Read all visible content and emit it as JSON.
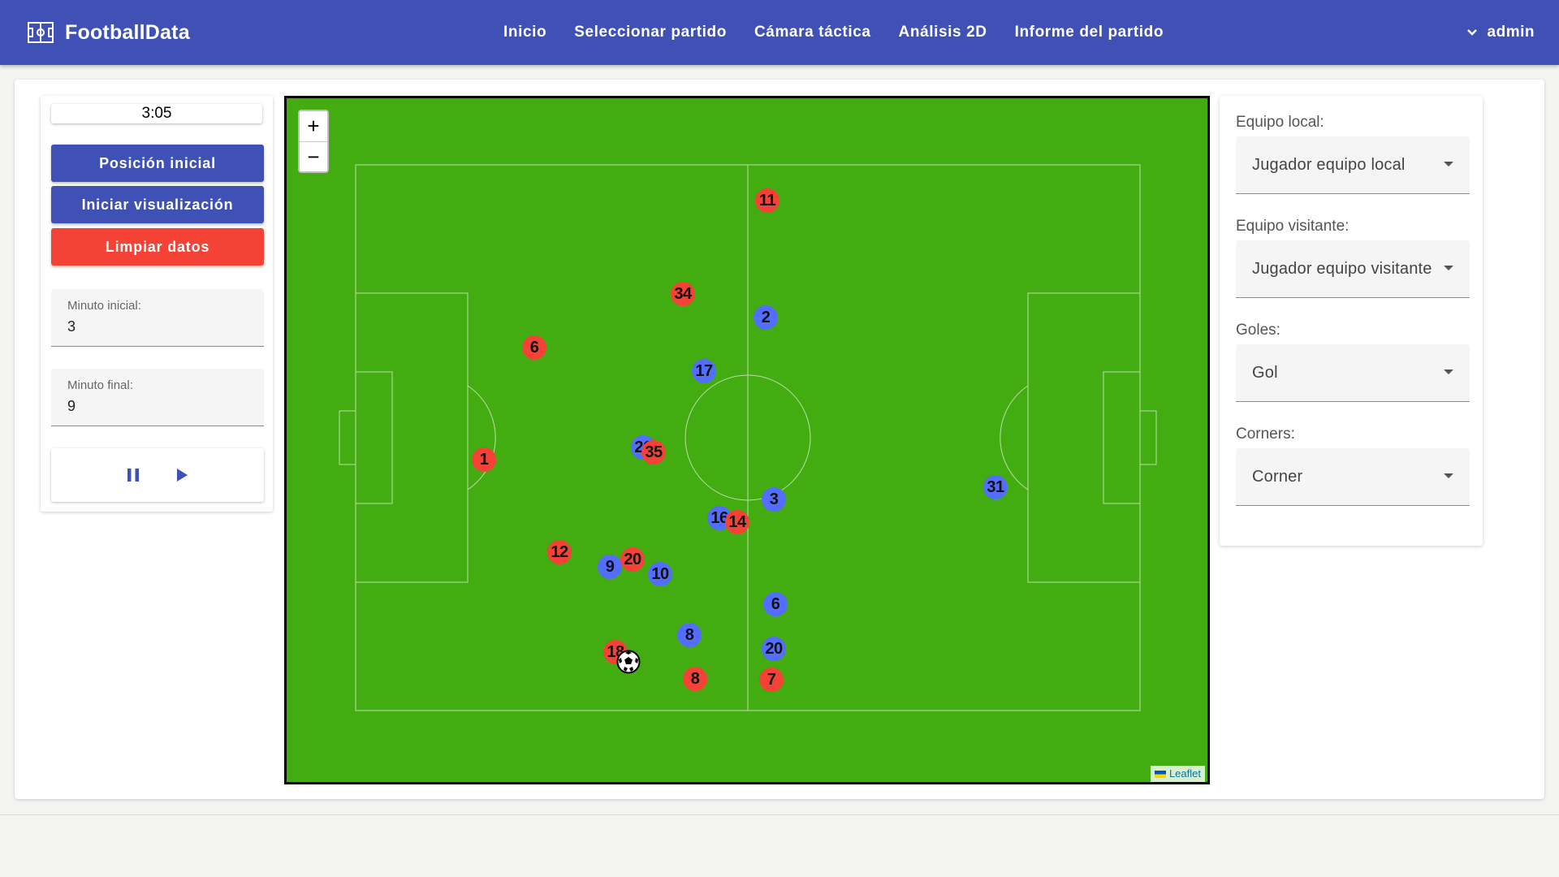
{
  "app": {
    "brand": "FootballData",
    "brand_icon": "pitch-icon"
  },
  "nav": {
    "items": [
      "Inicio",
      "Seleccionar partido",
      "Cámara táctica",
      "Análisis 2D",
      "Informe del partido"
    ],
    "user": "admin"
  },
  "left_panel": {
    "time": "3:05",
    "buttons": {
      "initial_position": "Posición inicial",
      "start_view": "Iniciar visualización",
      "clear_data": "Limpiar datos"
    },
    "start_minute": {
      "label": "Minuto inicial:",
      "value": "3"
    },
    "end_minute": {
      "label": "Minuto final:",
      "value": "9"
    },
    "playback": {
      "pause_icon": "pause-icon",
      "play_icon": "play-icon"
    }
  },
  "map": {
    "zoom_in": "+",
    "zoom_out": "−",
    "attribution": "Leaflet",
    "colors": {
      "pitch": "#43ac10",
      "home": "#f44336",
      "away": "#536dfe"
    },
    "home_players": [
      "11",
      "34",
      "6",
      "1",
      "35",
      "14",
      "12",
      "20",
      "18",
      "8",
      "7"
    ],
    "away_players": [
      "2",
      "17",
      "26",
      "3",
      "16",
      "31",
      "9",
      "10",
      "6",
      "8",
      "20"
    ]
  },
  "right_panel": {
    "home_team": {
      "label": "Equipo local:",
      "value": "Jugador equipo local"
    },
    "away_team": {
      "label": "Equipo visitante:",
      "value": "Jugador equipo visitante"
    },
    "goals": {
      "label": "Goles:",
      "value": "Gol"
    },
    "corners": {
      "label": "Corners:",
      "value": "Corner"
    }
  }
}
